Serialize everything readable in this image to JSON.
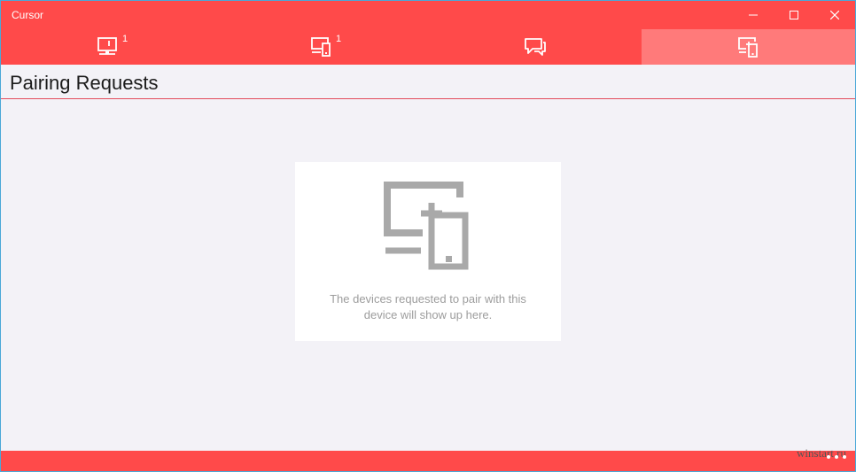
{
  "window": {
    "title": "Cursor"
  },
  "tabs": [
    {
      "icon": "desktop-icon",
      "badge": "1"
    },
    {
      "icon": "devices-icon",
      "badge": "1"
    },
    {
      "icon": "chat-icon",
      "badge": ""
    },
    {
      "icon": "pair-device-icon",
      "badge": "",
      "active": true
    }
  ],
  "header": {
    "title": "Pairing Requests"
  },
  "empty_state": {
    "icon": "pair-device-icon",
    "message": "The devices requested to pair with this device will show up here."
  },
  "footer": {
    "watermark": "winstart.ru"
  },
  "colors": {
    "accent": "#ff4a4a",
    "active_tab": "#ff7a7a",
    "background": "#f3f2f7",
    "divider": "#e34b5b"
  }
}
